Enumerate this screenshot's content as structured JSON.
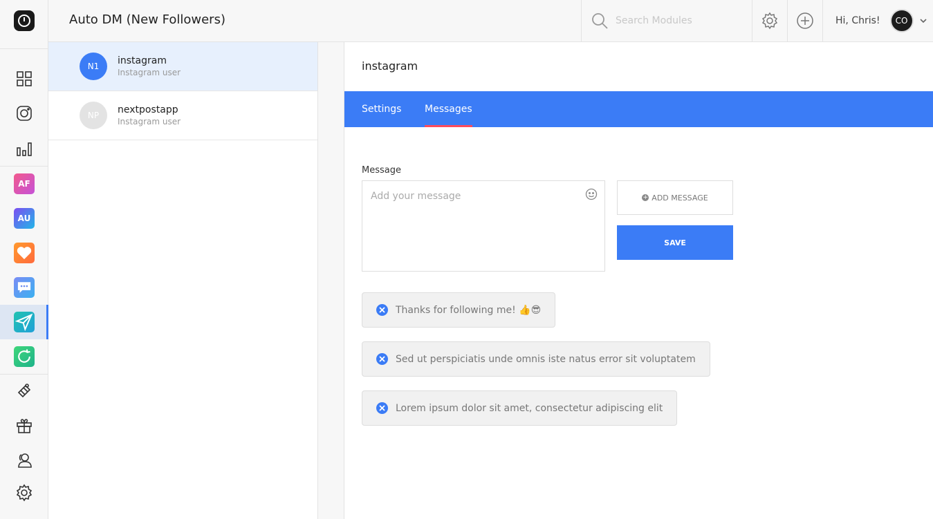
{
  "header": {
    "title": "Auto DM (New Followers)",
    "search_placeholder": "Search Modules",
    "greeting": "Hi, Chris!",
    "avatar_initials": "CO"
  },
  "rail": {
    "tiles": [
      {
        "label": "AF",
        "color": "#e04fa0"
      },
      {
        "label": "AU",
        "color": "#3e7ef7"
      }
    ]
  },
  "accounts": [
    {
      "initials": "N1",
      "name": "instagram",
      "type": "Instagram user",
      "active": true,
      "color": "#3b7cf6"
    },
    {
      "initials": "NP",
      "name": "nextpostapp",
      "type": "Instagram user",
      "active": false,
      "color": "#e3e3e3"
    }
  ],
  "main": {
    "account_title": "instagram",
    "tabs": [
      {
        "label": "Settings",
        "active": false
      },
      {
        "label": "Messages",
        "active": true
      }
    ],
    "message_label": "Message",
    "message_placeholder": "Add your message",
    "add_message_label": "ADD MESSAGE",
    "save_label": "SAVE",
    "messages": [
      "Thanks for following me! 👍😎",
      "Sed ut perspiciatis unde omnis iste natus error sit voluptatem",
      "Lorem ipsum dolor sit amet, consectetur adipiscing elit"
    ]
  },
  "colors": {
    "accent": "#3b7cf6",
    "tab_underline": "#ff4b5c"
  }
}
